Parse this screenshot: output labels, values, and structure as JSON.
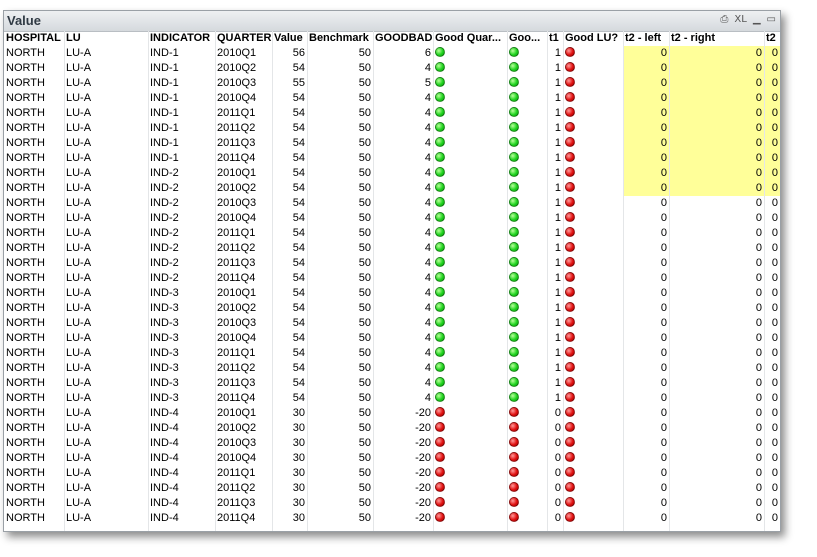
{
  "window": {
    "title": "Value",
    "icons": [
      "print-icon",
      "xl-export-icon",
      "minimize-icon",
      "maximize-icon"
    ],
    "xl_label": "XL"
  },
  "columns": [
    "HOSPITAL",
    "LU",
    "INDICATOR",
    "QUARTER",
    "Value",
    "Benchmark",
    "GOODBAD",
    "Good Quar...",
    "Goo...",
    "t1",
    "Good LU?",
    "t2 - left",
    "t2 - right",
    "t2"
  ],
  "colors": {
    "good": "#1fd21f",
    "bad": "#e01010",
    "highlight": "#ffff99"
  },
  "rows": [
    {
      "hospital": "NORTH",
      "lu": "LU-A",
      "indicator": "IND-1",
      "quarter": "2010Q1",
      "value": "56",
      "benchmark": "50",
      "goodbad": "6",
      "gq": "green",
      "goo": "green",
      "t1": "1",
      "glu": "red",
      "t2l": "0",
      "t2r": "0",
      "t2": "0",
      "hl": true
    },
    {
      "hospital": "NORTH",
      "lu": "LU-A",
      "indicator": "IND-1",
      "quarter": "2010Q2",
      "value": "54",
      "benchmark": "50",
      "goodbad": "4",
      "gq": "green",
      "goo": "green",
      "t1": "1",
      "glu": "red",
      "t2l": "0",
      "t2r": "0",
      "t2": "0",
      "hl": true
    },
    {
      "hospital": "NORTH",
      "lu": "LU-A",
      "indicator": "IND-1",
      "quarter": "2010Q3",
      "value": "55",
      "benchmark": "50",
      "goodbad": "5",
      "gq": "green",
      "goo": "green",
      "t1": "1",
      "glu": "red",
      "t2l": "0",
      "t2r": "0",
      "t2": "0",
      "hl": true
    },
    {
      "hospital": "NORTH",
      "lu": "LU-A",
      "indicator": "IND-1",
      "quarter": "2010Q4",
      "value": "54",
      "benchmark": "50",
      "goodbad": "4",
      "gq": "green",
      "goo": "green",
      "t1": "1",
      "glu": "red",
      "t2l": "0",
      "t2r": "0",
      "t2": "0",
      "hl": true
    },
    {
      "hospital": "NORTH",
      "lu": "LU-A",
      "indicator": "IND-1",
      "quarter": "2011Q1",
      "value": "54",
      "benchmark": "50",
      "goodbad": "4",
      "gq": "green",
      "goo": "green",
      "t1": "1",
      "glu": "red",
      "t2l": "0",
      "t2r": "0",
      "t2": "0",
      "hl": true
    },
    {
      "hospital": "NORTH",
      "lu": "LU-A",
      "indicator": "IND-1",
      "quarter": "2011Q2",
      "value": "54",
      "benchmark": "50",
      "goodbad": "4",
      "gq": "green",
      "goo": "green",
      "t1": "1",
      "glu": "red",
      "t2l": "0",
      "t2r": "0",
      "t2": "0",
      "hl": true
    },
    {
      "hospital": "NORTH",
      "lu": "LU-A",
      "indicator": "IND-1",
      "quarter": "2011Q3",
      "value": "54",
      "benchmark": "50",
      "goodbad": "4",
      "gq": "green",
      "goo": "green",
      "t1": "1",
      "glu": "red",
      "t2l": "0",
      "t2r": "0",
      "t2": "0",
      "hl": true
    },
    {
      "hospital": "NORTH",
      "lu": "LU-A",
      "indicator": "IND-1",
      "quarter": "2011Q4",
      "value": "54",
      "benchmark": "50",
      "goodbad": "4",
      "gq": "green",
      "goo": "green",
      "t1": "1",
      "glu": "red",
      "t2l": "0",
      "t2r": "0",
      "t2": "0",
      "hl": true
    },
    {
      "hospital": "NORTH",
      "lu": "LU-A",
      "indicator": "IND-2",
      "quarter": "2010Q1",
      "value": "54",
      "benchmark": "50",
      "goodbad": "4",
      "gq": "green",
      "goo": "green",
      "t1": "1",
      "glu": "red",
      "t2l": "0",
      "t2r": "0",
      "t2": "0",
      "hl": true
    },
    {
      "hospital": "NORTH",
      "lu": "LU-A",
      "indicator": "IND-2",
      "quarter": "2010Q2",
      "value": "54",
      "benchmark": "50",
      "goodbad": "4",
      "gq": "green",
      "goo": "green",
      "t1": "1",
      "glu": "red",
      "t2l": "0",
      "t2r": "0",
      "t2": "0",
      "hl": true
    },
    {
      "hospital": "NORTH",
      "lu": "LU-A",
      "indicator": "IND-2",
      "quarter": "2010Q3",
      "value": "54",
      "benchmark": "50",
      "goodbad": "4",
      "gq": "green",
      "goo": "green",
      "t1": "1",
      "glu": "red",
      "t2l": "0",
      "t2r": "0",
      "t2": "0",
      "hl": false
    },
    {
      "hospital": "NORTH",
      "lu": "LU-A",
      "indicator": "IND-2",
      "quarter": "2010Q4",
      "value": "54",
      "benchmark": "50",
      "goodbad": "4",
      "gq": "green",
      "goo": "green",
      "t1": "1",
      "glu": "red",
      "t2l": "0",
      "t2r": "0",
      "t2": "0",
      "hl": false
    },
    {
      "hospital": "NORTH",
      "lu": "LU-A",
      "indicator": "IND-2",
      "quarter": "2011Q1",
      "value": "54",
      "benchmark": "50",
      "goodbad": "4",
      "gq": "green",
      "goo": "green",
      "t1": "1",
      "glu": "red",
      "t2l": "0",
      "t2r": "0",
      "t2": "0",
      "hl": false
    },
    {
      "hospital": "NORTH",
      "lu": "LU-A",
      "indicator": "IND-2",
      "quarter": "2011Q2",
      "value": "54",
      "benchmark": "50",
      "goodbad": "4",
      "gq": "green",
      "goo": "green",
      "t1": "1",
      "glu": "red",
      "t2l": "0",
      "t2r": "0",
      "t2": "0",
      "hl": false
    },
    {
      "hospital": "NORTH",
      "lu": "LU-A",
      "indicator": "IND-2",
      "quarter": "2011Q3",
      "value": "54",
      "benchmark": "50",
      "goodbad": "4",
      "gq": "green",
      "goo": "green",
      "t1": "1",
      "glu": "red",
      "t2l": "0",
      "t2r": "0",
      "t2": "0",
      "hl": false
    },
    {
      "hospital": "NORTH",
      "lu": "LU-A",
      "indicator": "IND-2",
      "quarter": "2011Q4",
      "value": "54",
      "benchmark": "50",
      "goodbad": "4",
      "gq": "green",
      "goo": "green",
      "t1": "1",
      "glu": "red",
      "t2l": "0",
      "t2r": "0",
      "t2": "0",
      "hl": false
    },
    {
      "hospital": "NORTH",
      "lu": "LU-A",
      "indicator": "IND-3",
      "quarter": "2010Q1",
      "value": "54",
      "benchmark": "50",
      "goodbad": "4",
      "gq": "green",
      "goo": "green",
      "t1": "1",
      "glu": "red",
      "t2l": "0",
      "t2r": "0",
      "t2": "0",
      "hl": false
    },
    {
      "hospital": "NORTH",
      "lu": "LU-A",
      "indicator": "IND-3",
      "quarter": "2010Q2",
      "value": "54",
      "benchmark": "50",
      "goodbad": "4",
      "gq": "green",
      "goo": "green",
      "t1": "1",
      "glu": "red",
      "t2l": "0",
      "t2r": "0",
      "t2": "0",
      "hl": false
    },
    {
      "hospital": "NORTH",
      "lu": "LU-A",
      "indicator": "IND-3",
      "quarter": "2010Q3",
      "value": "54",
      "benchmark": "50",
      "goodbad": "4",
      "gq": "green",
      "goo": "green",
      "t1": "1",
      "glu": "red",
      "t2l": "0",
      "t2r": "0",
      "t2": "0",
      "hl": false
    },
    {
      "hospital": "NORTH",
      "lu": "LU-A",
      "indicator": "IND-3",
      "quarter": "2010Q4",
      "value": "54",
      "benchmark": "50",
      "goodbad": "4",
      "gq": "green",
      "goo": "green",
      "t1": "1",
      "glu": "red",
      "t2l": "0",
      "t2r": "0",
      "t2": "0",
      "hl": false
    },
    {
      "hospital": "NORTH",
      "lu": "LU-A",
      "indicator": "IND-3",
      "quarter": "2011Q1",
      "value": "54",
      "benchmark": "50",
      "goodbad": "4",
      "gq": "green",
      "goo": "green",
      "t1": "1",
      "glu": "red",
      "t2l": "0",
      "t2r": "0",
      "t2": "0",
      "hl": false
    },
    {
      "hospital": "NORTH",
      "lu": "LU-A",
      "indicator": "IND-3",
      "quarter": "2011Q2",
      "value": "54",
      "benchmark": "50",
      "goodbad": "4",
      "gq": "green",
      "goo": "green",
      "t1": "1",
      "glu": "red",
      "t2l": "0",
      "t2r": "0",
      "t2": "0",
      "hl": false
    },
    {
      "hospital": "NORTH",
      "lu": "LU-A",
      "indicator": "IND-3",
      "quarter": "2011Q3",
      "value": "54",
      "benchmark": "50",
      "goodbad": "4",
      "gq": "green",
      "goo": "green",
      "t1": "1",
      "glu": "red",
      "t2l": "0",
      "t2r": "0",
      "t2": "0",
      "hl": false
    },
    {
      "hospital": "NORTH",
      "lu": "LU-A",
      "indicator": "IND-3",
      "quarter": "2011Q4",
      "value": "54",
      "benchmark": "50",
      "goodbad": "4",
      "gq": "green",
      "goo": "green",
      "t1": "1",
      "glu": "red",
      "t2l": "0",
      "t2r": "0",
      "t2": "0",
      "hl": false
    },
    {
      "hospital": "NORTH",
      "lu": "LU-A",
      "indicator": "IND-4",
      "quarter": "2010Q1",
      "value": "30",
      "benchmark": "50",
      "goodbad": "-20",
      "gq": "red",
      "goo": "red",
      "t1": "0",
      "glu": "red",
      "t2l": "0",
      "t2r": "0",
      "t2": "0",
      "hl": false
    },
    {
      "hospital": "NORTH",
      "lu": "LU-A",
      "indicator": "IND-4",
      "quarter": "2010Q2",
      "value": "30",
      "benchmark": "50",
      "goodbad": "-20",
      "gq": "red",
      "goo": "red",
      "t1": "0",
      "glu": "red",
      "t2l": "0",
      "t2r": "0",
      "t2": "0",
      "hl": false
    },
    {
      "hospital": "NORTH",
      "lu": "LU-A",
      "indicator": "IND-4",
      "quarter": "2010Q3",
      "value": "30",
      "benchmark": "50",
      "goodbad": "-20",
      "gq": "red",
      "goo": "red",
      "t1": "0",
      "glu": "red",
      "t2l": "0",
      "t2r": "0",
      "t2": "0",
      "hl": false
    },
    {
      "hospital": "NORTH",
      "lu": "LU-A",
      "indicator": "IND-4",
      "quarter": "2010Q4",
      "value": "30",
      "benchmark": "50",
      "goodbad": "-20",
      "gq": "red",
      "goo": "red",
      "t1": "0",
      "glu": "red",
      "t2l": "0",
      "t2r": "0",
      "t2": "0",
      "hl": false
    },
    {
      "hospital": "NORTH",
      "lu": "LU-A",
      "indicator": "IND-4",
      "quarter": "2011Q1",
      "value": "30",
      "benchmark": "50",
      "goodbad": "-20",
      "gq": "red",
      "goo": "red",
      "t1": "0",
      "glu": "red",
      "t2l": "0",
      "t2r": "0",
      "t2": "0",
      "hl": false
    },
    {
      "hospital": "NORTH",
      "lu": "LU-A",
      "indicator": "IND-4",
      "quarter": "2011Q2",
      "value": "30",
      "benchmark": "50",
      "goodbad": "-20",
      "gq": "red",
      "goo": "red",
      "t1": "0",
      "glu": "red",
      "t2l": "0",
      "t2r": "0",
      "t2": "0",
      "hl": false
    },
    {
      "hospital": "NORTH",
      "lu": "LU-A",
      "indicator": "IND-4",
      "quarter": "2011Q3",
      "value": "30",
      "benchmark": "50",
      "goodbad": "-20",
      "gq": "red",
      "goo": "red",
      "t1": "0",
      "glu": "red",
      "t2l": "0",
      "t2r": "0",
      "t2": "0",
      "hl": false
    },
    {
      "hospital": "NORTH",
      "lu": "LU-A",
      "indicator": "IND-4",
      "quarter": "2011Q4",
      "value": "30",
      "benchmark": "50",
      "goodbad": "-20",
      "gq": "red",
      "goo": "red",
      "t1": "0",
      "glu": "red",
      "t2l": "0",
      "t2r": "0",
      "t2": "0",
      "hl": false
    }
  ]
}
